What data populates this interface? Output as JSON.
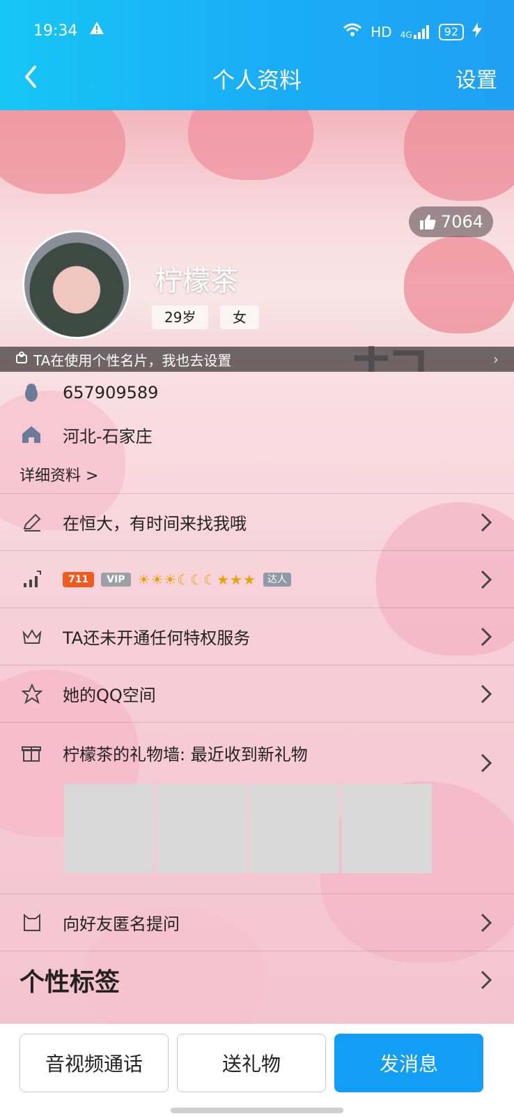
{
  "status": {
    "time": "19:34",
    "network": "HD",
    "signal": "4G",
    "battery": "92"
  },
  "header": {
    "title": "个人资料",
    "settings_label": "设置"
  },
  "profile": {
    "likes": "7064",
    "nickname": "柠檬茶",
    "age": "29岁",
    "gender": "女",
    "card_notice": "TA在使用个性名片，我也去设置",
    "qq_number": "657909589",
    "location": "河北-石家庄",
    "detail_link": "详细资料 >"
  },
  "rows": {
    "signature": "在恒大，有时间来找我哦",
    "badge_level": "711",
    "badge_vip": "VIP",
    "level_icons": "☀☀☀☾☾☾★★★",
    "badge_talent": "达人",
    "privilege": "TA还未开通任何特权服务",
    "qzone": "她的QQ空间",
    "gift_wall": "柠檬茶的礼物墙: 最近收到新礼物",
    "anon_question": "向好友匿名提问",
    "tags_title": "个性标签"
  },
  "bottom": {
    "call": "音视频通话",
    "gift": "送礼物",
    "message": "发消息"
  },
  "colors": {
    "accent": "#139ef5",
    "topbar": "#1aaef6",
    "fire": "#f05a1f"
  }
}
